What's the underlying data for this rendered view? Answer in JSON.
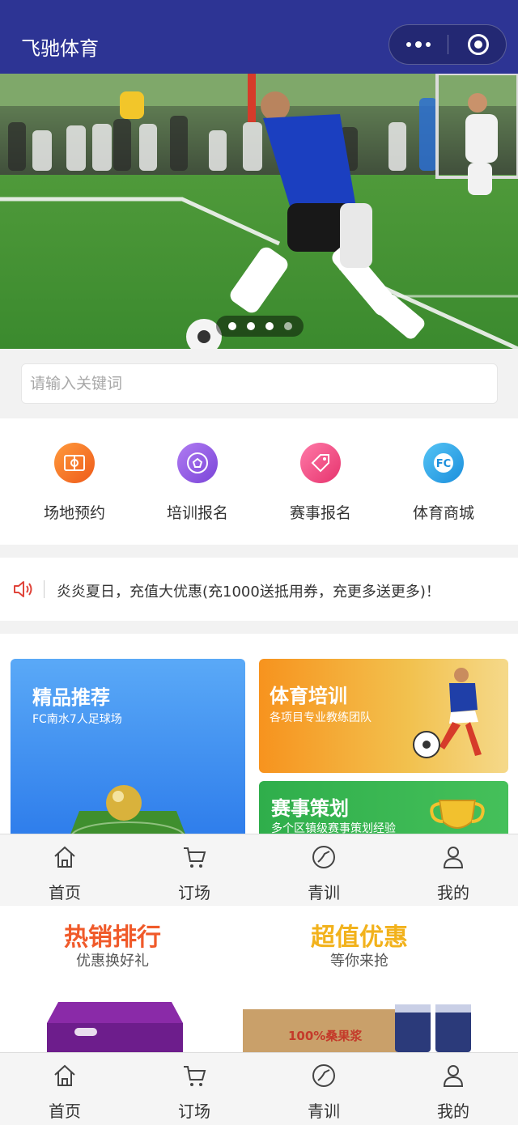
{
  "header": {
    "title": "飞驰体育",
    "more_icon": "more-dots-icon",
    "close_icon": "target-icon"
  },
  "banner": {
    "slide_count": 4,
    "active_index": 0
  },
  "search": {
    "placeholder": "请输入关键词",
    "value": ""
  },
  "nav": [
    {
      "label": "场地预约",
      "icon": "venue-icon",
      "color": "#f07a24"
    },
    {
      "label": "培训报名",
      "icon": "soccer-ball-icon",
      "color": "#9b5de5"
    },
    {
      "label": "赛事报名",
      "icon": "tag-icon",
      "color": "#f0508c"
    },
    {
      "label": "体育商城",
      "icon": "fc-logo-icon",
      "color": "#2aa6e8"
    }
  ],
  "notice": {
    "icon": "speaker-icon",
    "text": "炎炎夏日，充值大优惠(充1000送抵用券，充更多送更多)！"
  },
  "cards": {
    "featured": {
      "title": "精品推荐",
      "subtitle": "FC南水7人足球场"
    },
    "training": {
      "title": "体育培训",
      "subtitle": "各项目专业教练团队"
    },
    "events": {
      "title": "赛事策划",
      "subtitle": "多个区镇级赛事策划经验"
    }
  },
  "promo": {
    "hot": {
      "title": "热销排行",
      "subtitle": "优惠换好礼"
    },
    "deal": {
      "title": "超值优惠",
      "subtitle": "等你来抢"
    },
    "product_text": "100%桑果浆"
  },
  "tabbar": [
    {
      "label": "首页",
      "icon": "home-icon"
    },
    {
      "label": "订场",
      "icon": "cart-icon"
    },
    {
      "label": "青训",
      "icon": "ball-icon"
    },
    {
      "label": "我的",
      "icon": "user-icon"
    }
  ]
}
